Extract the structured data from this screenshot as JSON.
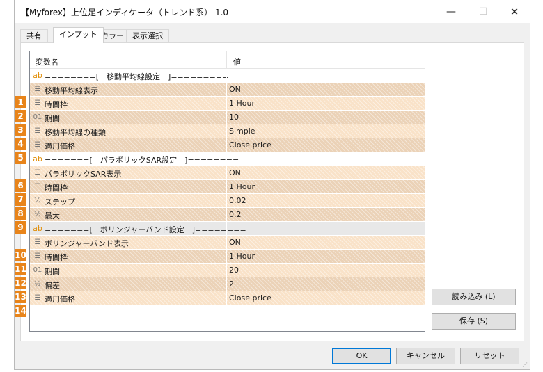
{
  "window": {
    "title": "【Myforex】上位足インディケータ（トレンド系） 1.0",
    "minimize_glyph": "—",
    "maximize_glyph": "☐",
    "close_glyph": "✕"
  },
  "tabs": [
    {
      "label": "共有",
      "active": false
    },
    {
      "label": "インプット",
      "active": true
    },
    {
      "label": "カラー",
      "active": false
    },
    {
      "label": "表示選択",
      "active": false
    }
  ],
  "grid": {
    "header_name": "変数名",
    "header_value": "値",
    "rows": [
      {
        "num": "",
        "icon": "ab",
        "name": "========[　移動平均線設定　]=========",
        "value": ""
      },
      {
        "num": "1",
        "icon": "list",
        "name": "移動平均線表示",
        "value": "ON"
      },
      {
        "num": "2",
        "icon": "list",
        "name": "時間枠",
        "value": "1 Hour"
      },
      {
        "num": "3",
        "icon": "01",
        "name": "期間",
        "value": "10"
      },
      {
        "num": "4",
        "icon": "list",
        "name": "移動平均線の種類",
        "value": "Simple"
      },
      {
        "num": "5",
        "icon": "list",
        "name": "適用価格",
        "value": "Close price"
      },
      {
        "num": "",
        "icon": "ab",
        "name": "=======[　パラボリックSAR設定　]========",
        "value": ""
      },
      {
        "num": "6",
        "icon": "list",
        "name": "パラボリックSAR表示",
        "value": "ON"
      },
      {
        "num": "7",
        "icon": "list",
        "name": "時間枠",
        "value": "1 Hour"
      },
      {
        "num": "8",
        "icon": "half",
        "name": "ステップ",
        "value": "0.02"
      },
      {
        "num": "9",
        "icon": "half",
        "name": "最大",
        "value": "0.2"
      },
      {
        "num": "",
        "icon": "ab",
        "name": "=======[　ボリンジャーバンド設定　]========",
        "value": ""
      },
      {
        "num": "10",
        "icon": "list",
        "name": "ボリンジャーバンド表示",
        "value": "ON"
      },
      {
        "num": "11",
        "icon": "list",
        "name": "時間枠",
        "value": "1 Hour"
      },
      {
        "num": "12",
        "icon": "01",
        "name": "期間",
        "value": "20"
      },
      {
        "num": "13",
        "icon": "half",
        "name": "偏差",
        "value": "2"
      },
      {
        "num": "14",
        "icon": "list",
        "name": "適用価格",
        "value": "Close price"
      }
    ]
  },
  "icons": {
    "ab": "ab",
    "list": "☰",
    "01": "01",
    "half": "½"
  },
  "buttons": {
    "load": "読み込み (L)",
    "save": "保存 (S)",
    "ok": "OK",
    "cancel": "キャンセル",
    "reset": "リセット"
  },
  "colors": {
    "badge": "#e8841a",
    "accent": "#0078d7"
  }
}
